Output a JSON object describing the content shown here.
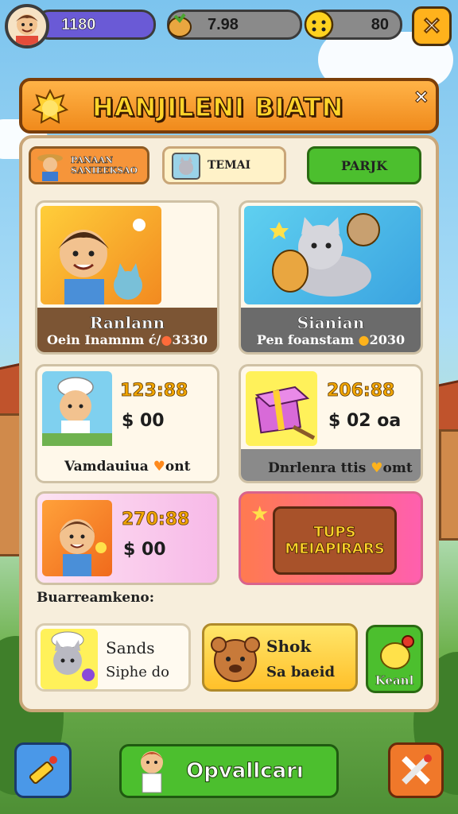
{
  "hud": {
    "level_value": "1180",
    "coins_value": "7.98",
    "gems_value": "80",
    "close_icon": "close-x-icon"
  },
  "banner": {
    "title": "HANJILENI BIATN",
    "close_glyph": "×"
  },
  "tabs": [
    {
      "label": "PANAAN SANIEEKSAO",
      "active": true
    },
    {
      "label": "TEMAI",
      "active": false
    },
    {
      "label": "PARJK",
      "active": false
    }
  ],
  "offers": [
    {
      "title": "Ranlann",
      "subtitle": "Oein Inamnm ć/",
      "price": "3330"
    },
    {
      "title": "Sianian",
      "subtitle": "Pen foanstam",
      "price": "2030"
    }
  ],
  "items": [
    {
      "price": "123:88",
      "cost": "$ 00",
      "caption": "Vamdauiua",
      "caption_tail": "ont"
    },
    {
      "price": "206:88",
      "cost": "$ 02 oa",
      "caption": "Dnrlenra ttis",
      "caption_tail": "omt"
    },
    {
      "price": "270:88",
      "cost": "$ 00"
    }
  ],
  "promo": {
    "line1": "TUPS",
    "line2": "MEIAPIRARS"
  },
  "section_label": "Buarreamkeno:",
  "bottom_items": [
    {
      "name": "Sands",
      "detail": "Siphe do"
    },
    {
      "name": "Shok",
      "detail": "Sa baeid"
    },
    {
      "name": "Keanl"
    }
  ],
  "footer": {
    "main_label": "Opvallcarı"
  },
  "colors": {
    "accent_orange": "#f08a1c",
    "green": "#4cbf2e",
    "purple": "#6a5ad6"
  }
}
